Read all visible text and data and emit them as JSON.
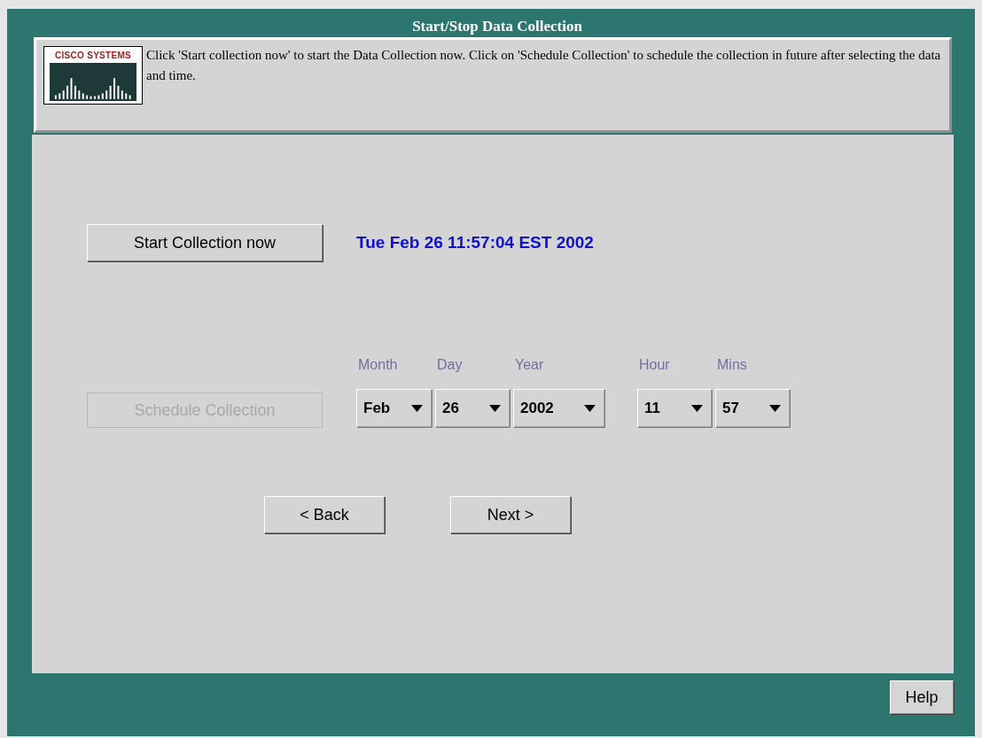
{
  "window": {
    "title": "Start/Stop Data Collection"
  },
  "header": {
    "logo_text": "CISCO SYSTEMS",
    "message": "Click 'Start collection now' to start the Data Collection now. Click on 'Schedule Collection' to schedule the collection in future after selecting the data and time."
  },
  "start_button": {
    "label": "Start Collection now",
    "disabled": false
  },
  "current_time": "Tue Feb 26 11:57:04 EST 2002",
  "schedule_button": {
    "label": "Schedule Collection",
    "disabled": true
  },
  "date_fields": [
    {
      "label": "Month",
      "value": "Feb"
    },
    {
      "label": "Day",
      "value": "26"
    },
    {
      "label": "Year",
      "value": "2002"
    }
  ],
  "time_fields": [
    {
      "label": "Hour",
      "value": "11"
    },
    {
      "label": "Mins",
      "value": "57"
    }
  ],
  "nav_buttons": [
    {
      "label": "< Back"
    },
    {
      "label": "Next >"
    }
  ],
  "help_button": {
    "label": "Help"
  }
}
